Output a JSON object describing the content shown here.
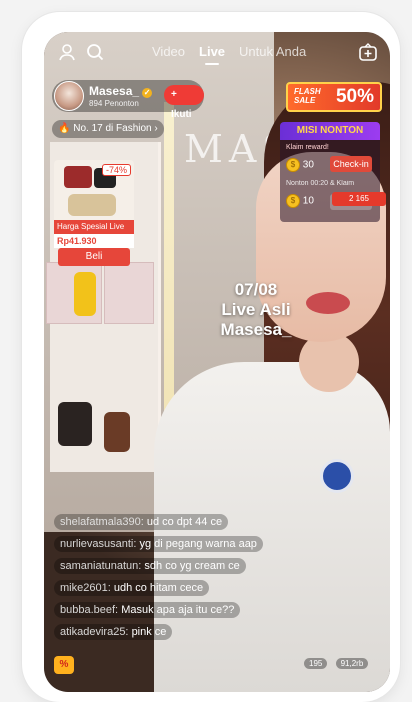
{
  "nav": {
    "tabs": [
      {
        "label": "Video"
      },
      {
        "label": "Live"
      },
      {
        "label": "Untuk Anda"
      }
    ]
  },
  "host": {
    "name": "Masesa_",
    "viewers": "894 Penonton",
    "follow_label": "+ Ikuti",
    "rank": "No. 17 di Fashion"
  },
  "product": {
    "discount": "-74%",
    "label": "Harga Spesial Live",
    "price": "Rp41.930",
    "buy_label": "Beli"
  },
  "flash_sale": {
    "title_line1": "FLASH",
    "title_line2": "SALE",
    "percent": "50%"
  },
  "mission": {
    "title": "MISI NONTON",
    "sub": "Klaim reward!",
    "coin1": "30",
    "checkin_label": "Check-in",
    "sub2": "Nonton 00:20 & Klaim",
    "coin2": "10",
    "klaim_label": "Klaim",
    "gift": "2  165"
  },
  "overlay": {
    "line1": "07/08",
    "line2": "Live Asli",
    "line3": "Masesa_"
  },
  "background": {
    "wall_text": "MAS"
  },
  "comments": [
    {
      "user": "shelafatmala390:",
      "text": "ud co dpt 44 ce"
    },
    {
      "user": "nurlievasusanti:",
      "text": "yg di pegang warna aap"
    },
    {
      "user": "samaniatunatun:",
      "text": "sdh co yg cream ce"
    },
    {
      "user": "mike2601:",
      "text": "udh co hitam cece"
    },
    {
      "user": "bubba.beef:",
      "text": "Masuk apa aja itu ce??"
    },
    {
      "user": "atikadevira25:",
      "text": "pink ce"
    }
  ],
  "bottom": {
    "left_badge": "%",
    "count1": "195",
    "count2": "91,2rb"
  }
}
